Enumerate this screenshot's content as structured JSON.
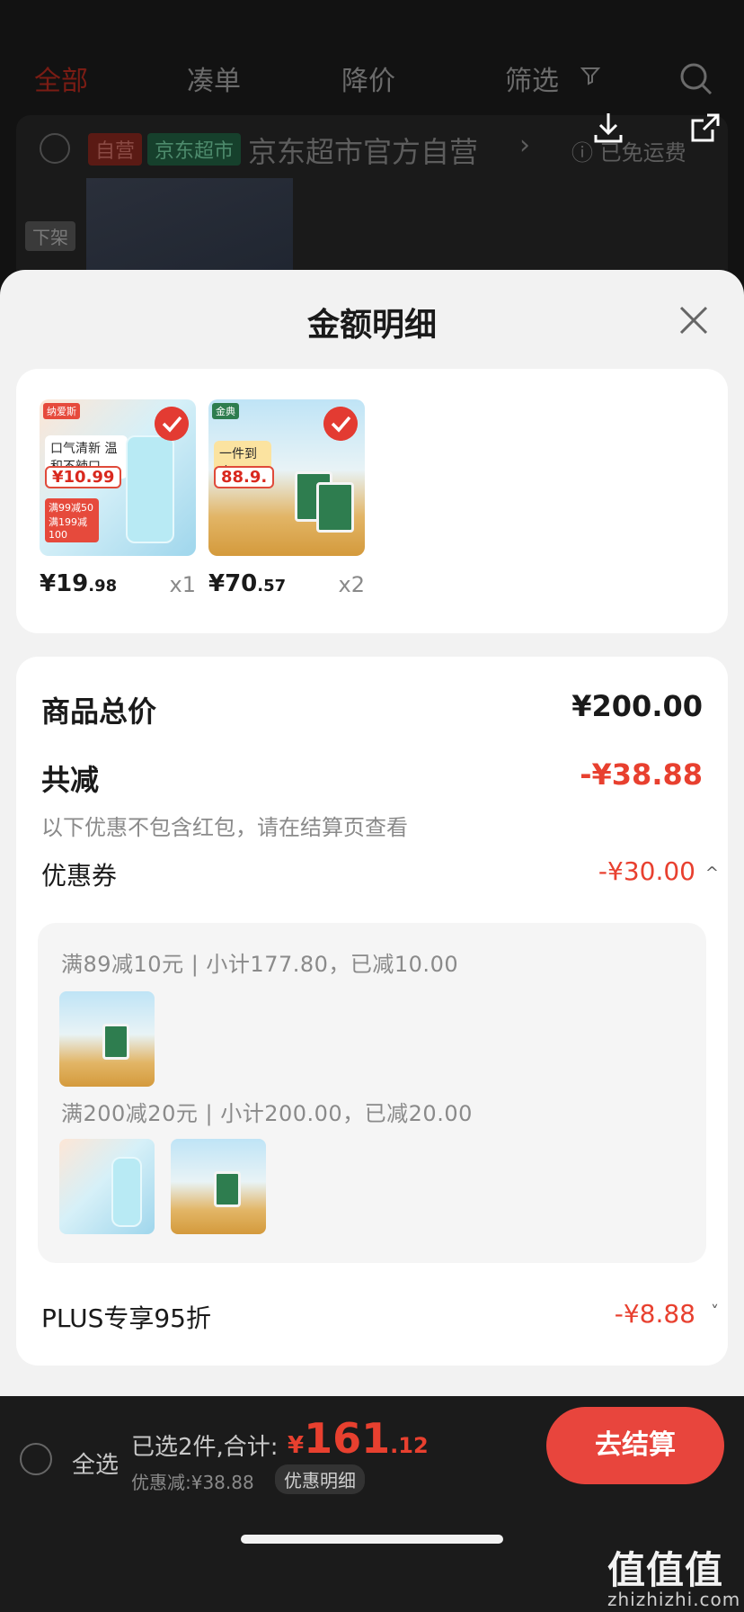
{
  "header": {
    "tabs": [
      {
        "label": "全部",
        "active": true
      },
      {
        "label": "凑单",
        "active": false
      },
      {
        "label": "降价",
        "active": false
      },
      {
        "label": "筛选",
        "active": false
      }
    ]
  },
  "store": {
    "tag_self": "自营",
    "tag_jd": "京东超市",
    "name": "京东超市官方自营",
    "arrow": "›",
    "shipping": "ⓘ 已免运费",
    "offshelf": "下架"
  },
  "sheet": {
    "title": "金额明细",
    "products": [
      {
        "price_main": "¥19",
        "price_dec": ".98",
        "qty": "x1",
        "brand": "纳爱斯",
        "label": "口气清新 温和不辣口",
        "promo_price": "¥10.99",
        "promo_tag": "满99减50 满199减100"
      },
      {
        "price_main": "¥70",
        "price_dec": ".57",
        "qty": "x2",
        "brand": "金典",
        "label": "一件到底",
        "promo_price": "88.9."
      }
    ],
    "total_label": "商品总价",
    "total_value": "¥200.00",
    "reduce_label": "共减",
    "reduce_value": "-¥38.88",
    "note": "以下优惠不包含红包，请在结算页查看",
    "coupon_label": "优惠券",
    "coupon_value": "-¥30.00",
    "coupon_chevron": "^",
    "coupon_lines": [
      "满89减10元 | 小计177.80，已减10.00",
      "满200减20元 | 小计200.00，已减20.00"
    ],
    "plus_label": "PLUS专享95折",
    "plus_value": "-¥8.88",
    "plus_chevron": "˅"
  },
  "bottom": {
    "select_all": "全选",
    "summary": "已选2件,合计:",
    "currency": "¥",
    "total_main": "161",
    "total_dec": ".12",
    "discount": "优惠减:¥38.88",
    "detail_btn": "优惠明细",
    "checkout": "去结算"
  },
  "watermark": {
    "text": "值值值",
    "url": "zhizhizhi.com"
  },
  "colors": {
    "accent": "#e8402f",
    "checkout_bg": "#e8453d"
  }
}
